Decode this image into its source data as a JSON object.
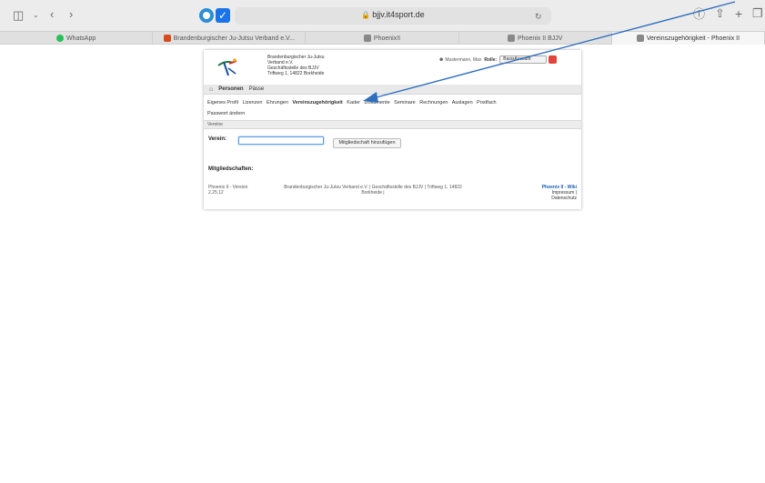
{
  "browser": {
    "url": "bjjv.it4sport.de",
    "tabs": [
      {
        "label": "WhatsApp",
        "favicon": "whatsapp-icon"
      },
      {
        "label": "Brandenburgischer Ju-Jutsu Verband e.V...",
        "favicon": "bjjv-icon"
      },
      {
        "label": "Phoenix!I",
        "favicon": "page-icon"
      },
      {
        "label": "Phoenix II BJJV",
        "favicon": "page-icon"
      },
      {
        "label": "Vereinszugehörigkeit - Phoenix II",
        "favicon": "page-icon",
        "active": true
      }
    ]
  },
  "page": {
    "org": {
      "line1": "Brandenburgischer Ju-Jutsu",
      "line2": "Verband e.V.",
      "line3": "Geschäftsstelle des BJJV",
      "line4": "Triftweg 1, 14822 Borkheide"
    },
    "user": {
      "name": "Mustermann, Max",
      "role_label": "Rolle:",
      "role_value": "BasisAccount"
    },
    "mainnav": {
      "personen": "Personen",
      "paesse": "Pässe"
    },
    "subnav": [
      "Eigenes Profil",
      "Lizenzen",
      "Ehrungen",
      "Vereinszugehörigkeit",
      "Kader",
      "Dokumente",
      "Seminare",
      "Rechnungen",
      "Auslagen",
      "Postfach",
      "Passwort ändern"
    ],
    "section_title": "Vereine",
    "verein_label": "Verein:",
    "add_button": "Mitgliedschaft hinzufügen",
    "mitgliedschaften": "Mitgliedschaften:",
    "footer": {
      "version_line1": "Phoenix II - Version",
      "version_line2": "2.25.12",
      "mid_line1": "Brandenburgischer Ju-Jutsu Verband e.V. | Geschäftsstelle des BJJV | Triftweg 1, 14822",
      "mid_line2": "Borkheide |",
      "wiki": "Phoenix II - Wiki",
      "impressum": "Impressum |",
      "datenschutz": "Datenschutz"
    }
  }
}
